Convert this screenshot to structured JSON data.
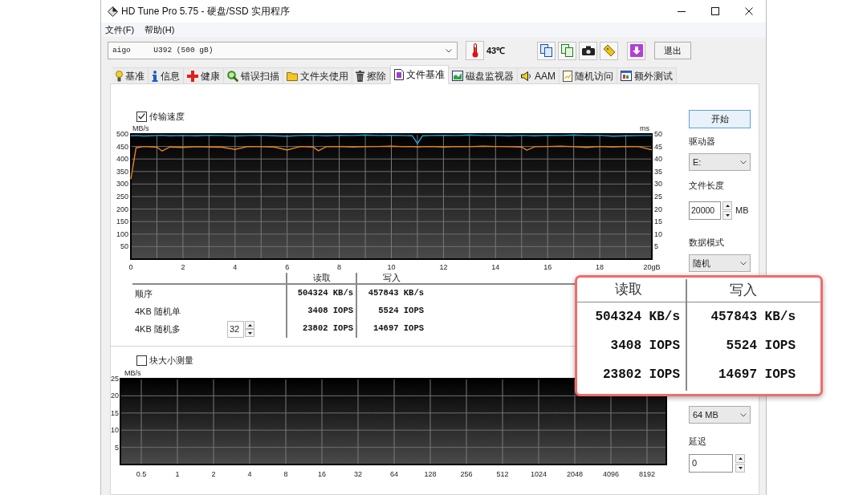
{
  "window": {
    "title": "HD Tune Pro 5.75 - 硬盘/SSD 实用程序"
  },
  "menu": [
    {
      "label": "文件(F)"
    },
    {
      "label": "帮助(H)"
    }
  ],
  "toolbar": {
    "drive": "aigo     U392 (500 gB)",
    "temperature": "43℃",
    "exit_button": "退出"
  },
  "tabs": [
    {
      "label": "基准",
      "selected": false
    },
    {
      "label": "信息",
      "selected": false
    },
    {
      "label": "健康",
      "selected": false
    },
    {
      "label": "错误扫描",
      "selected": false
    },
    {
      "label": "文件夹使用",
      "selected": false
    },
    {
      "label": "擦除",
      "selected": false
    },
    {
      "label": "文件基准",
      "selected": true
    },
    {
      "label": "磁盘监视器",
      "selected": false
    },
    {
      "label": "AAM",
      "selected": false
    },
    {
      "label": "随机访问",
      "selected": false
    },
    {
      "label": "额外测试",
      "selected": false
    }
  ],
  "transfer_speed": {
    "label": "传输速度",
    "checked": true,
    "chart_data": {
      "type": "line",
      "ylabel": "MB/s",
      "y2label": "ms",
      "x": [
        0,
        0.2,
        0.5,
        1,
        1.2,
        1.5,
        2,
        2.5,
        3,
        3.5,
        4,
        4.5,
        5,
        5.5,
        6,
        6.5,
        7,
        7.2,
        7.5,
        8,
        8.5,
        9,
        9.5,
        10,
        10.5,
        10.8,
        11,
        11.2,
        11.5,
        12,
        12.5,
        13,
        13.5,
        14,
        14.5,
        15,
        15.2,
        15.5,
        16,
        16.5,
        17,
        17.5,
        18,
        18.5,
        19,
        19.5,
        20
      ],
      "series": [
        {
          "color": "#25a3d6",
          "values": [
            493,
            494,
            492,
            494,
            495,
            493,
            494,
            493,
            495,
            494,
            492,
            494,
            495,
            493,
            491,
            494,
            495,
            494,
            493,
            495,
            494,
            496,
            494,
            495,
            494,
            493,
            462,
            493,
            494,
            495,
            494,
            496,
            494,
            495,
            493,
            495,
            494,
            493,
            495,
            494,
            496,
            494,
            495,
            491,
            493,
            494,
            494
          ]
        },
        {
          "color": "#e8821e",
          "values": [
            320,
            445,
            450,
            447,
            432,
            448,
            446,
            449,
            448,
            447,
            438,
            450,
            449,
            448,
            436,
            450,
            448,
            433,
            449,
            450,
            448,
            449,
            450,
            451,
            449,
            450,
            448,
            449,
            450,
            448,
            450,
            449,
            451,
            450,
            449,
            448,
            435,
            449,
            450,
            451,
            449,
            446,
            450,
            448,
            450,
            449,
            437
          ]
        }
      ],
      "xlim": [
        0,
        20
      ],
      "ylim": [
        0,
        500
      ],
      "y2lim": [
        0,
        50
      ],
      "xticks": [
        0,
        2,
        4,
        6,
        8,
        10,
        12,
        14,
        16,
        18,
        {
          "value": 20,
          "label": "20gB"
        }
      ],
      "yticks": [
        50,
        100,
        150,
        200,
        250,
        300,
        350,
        400,
        450,
        500
      ],
      "y2ticks": [
        5,
        10,
        15,
        20,
        25,
        30,
        35,
        40,
        45,
        50
      ],
      "grid": true
    }
  },
  "results": {
    "columns": [
      "读取",
      "写入"
    ],
    "rows": [
      {
        "label": "顺序",
        "values": [
          "504324 KB/s",
          "457843 KB/s"
        ]
      },
      {
        "label": "4KB 随机单",
        "values": [
          "3408 IOPS",
          "5524 IOPS"
        ]
      },
      {
        "label": "4KB 随机多",
        "spinner": "32",
        "values": [
          "23802 IOPS",
          "14697 IOPS"
        ]
      }
    ]
  },
  "block_size_test": {
    "label": "块大小测量",
    "checked": false,
    "chart_data": {
      "type": "bar",
      "ylabel": "MB/s",
      "categories": [
        "0.5",
        "1",
        "2",
        "4",
        "8",
        "16",
        "32",
        "64",
        "128",
        "256",
        "512",
        "1024",
        "2048",
        "4096",
        "8192"
      ],
      "ylim": [
        0,
        25
      ],
      "yticks": [
        5,
        10,
        15,
        20,
        25
      ],
      "grid": true
    }
  },
  "settings": {
    "start_button": "开始",
    "drive": {
      "label": "驱动器",
      "value": "E:"
    },
    "file_length": {
      "label": "文件长度",
      "value": "20000",
      "unit": "MB"
    },
    "data_mode": {
      "label": "数据模式",
      "value": "随机"
    },
    "block_size": {
      "value": "64 MB"
    },
    "delay": {
      "label": "延迟",
      "value": "0"
    }
  },
  "zoom_callout": {
    "columns": [
      "读取",
      "写入"
    ],
    "rows": [
      [
        "504324 KB/s",
        "457843 KB/s"
      ],
      [
        "3408 IOPS",
        "5524 IOPS"
      ],
      [
        "23802 IOPS",
        "14697 IOPS"
      ]
    ]
  }
}
